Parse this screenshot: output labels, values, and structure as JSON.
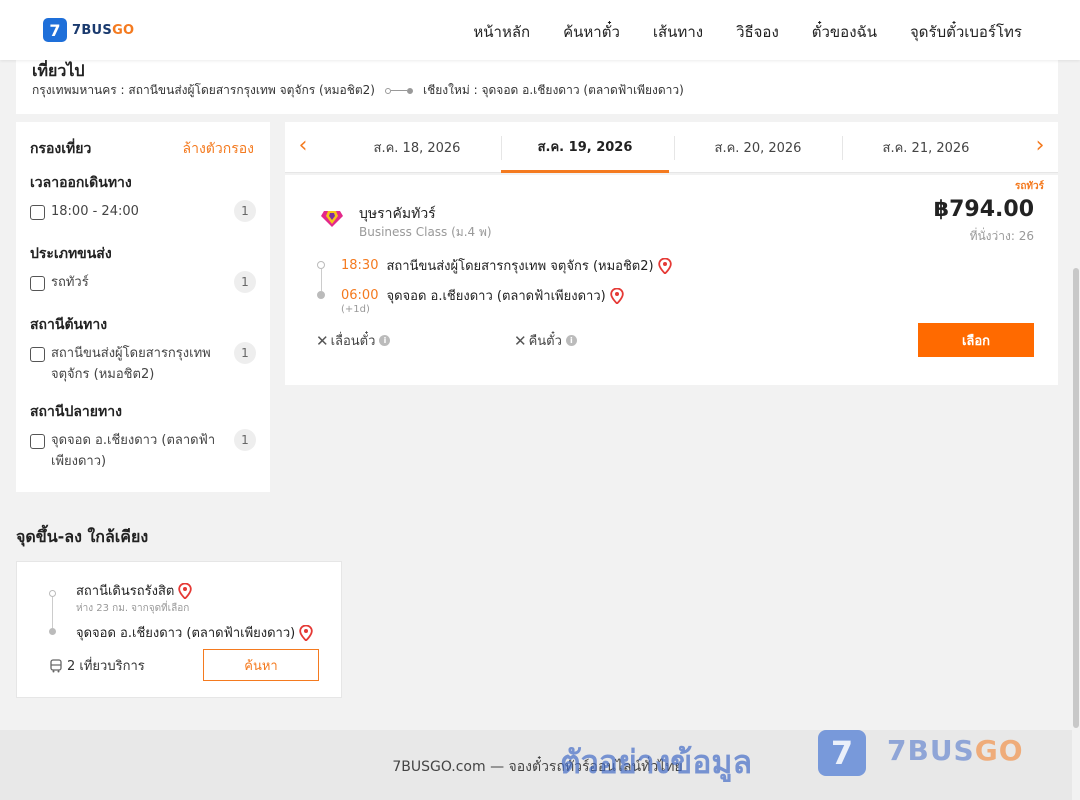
{
  "header": {
    "logo_text_a": "7BUS",
    "logo_text_b": "GO",
    "logo_mark": "7",
    "nav": [
      "หน้าหลัก",
      "ค้นหาตั๋ว",
      "เส้นทาง",
      "วิธีจอง",
      "ตั๋วของฉัน",
      "จุดรับตั๋วเบอร์โทร"
    ]
  },
  "trip": {
    "title": "เที่ยวไป",
    "from": "กรุงเทพมหานคร : สถานีขนส่งผู้โดยสารกรุงเทพ จตุจักร (หมอชิต2)",
    "to": "เชียงใหม่ : จุดจอด อ.เชียงดาว (ตลาดฟ้าเพียงดาว)"
  },
  "filters": {
    "title": "กรองเที่ยว",
    "clear": "ล้างตัวกรอง",
    "sections": [
      {
        "title": "เวลาออกเดินทาง",
        "option": "18:00 - 24:00",
        "count": "1"
      },
      {
        "title": "ประเภทขนส่ง",
        "option": "รถทัวร์",
        "count": "1"
      },
      {
        "title": "สถานีต้นทาง",
        "option": "สถานีขนส่งผู้โดยสารกรุงเทพ จตุจักร (หมอชิต2)",
        "count": "1"
      },
      {
        "title": "สถานีปลายทาง",
        "option": "จุดจอด อ.เชียงดาว (ตลาดฟ้าเพียงดาว)",
        "count": "1"
      }
    ]
  },
  "dates": [
    "ส.ค. 18, 2026",
    "ส.ค. 19, 2026",
    "ส.ค. 20, 2026",
    "ส.ค. 21, 2026"
  ],
  "result": {
    "badge": "รถทัวร์",
    "operator": "บุษราคัมทัวร์",
    "bus_class": "Business Class (ม.4 พ)",
    "price": "฿794.00",
    "seats": "ที่นั่งว่าง: 26",
    "depart_time": "18:30",
    "depart_station": "สถานีขนส่งผู้โดยสารกรุงเทพ จตุจักร (หมอชิต2)",
    "arrive_time": "06:00",
    "arrive_station": "จุดจอด อ.เชียงดาว (ตลาดฟ้าเพียงดาว)",
    "next_day": "(+1d)",
    "policy_change": "เลื่อนตั๋ว",
    "policy_refund": "คืนตั๋ว",
    "select": "เลือก"
  },
  "nearby": {
    "title": "จุดขึ้น-ลง ใกล้เคียง",
    "from": "สถานีเดินรถรังสิต",
    "distance": "ห่าง 23 กม. จากจุดที่เลือก",
    "to": "จุดจอด อ.เชียงดาว (ตลาดฟ้าเพียงดาว)",
    "trips": "2 เที่ยวบริการ",
    "search": "ค้นหา"
  },
  "footer": {
    "text": "7BUSGO.com — จองตั๋วรถทัวร์ออนไลน์ทั่วไทย",
    "watermark": "ตัวอย่างข้อมูล",
    "wm_mark": "7",
    "wm_brand_a": "7BUS",
    "wm_brand_b": "GO"
  },
  "colors": {
    "accent": "#f47a1f",
    "button": "#ff6a00",
    "brand_blue": "#1e6fd9"
  }
}
